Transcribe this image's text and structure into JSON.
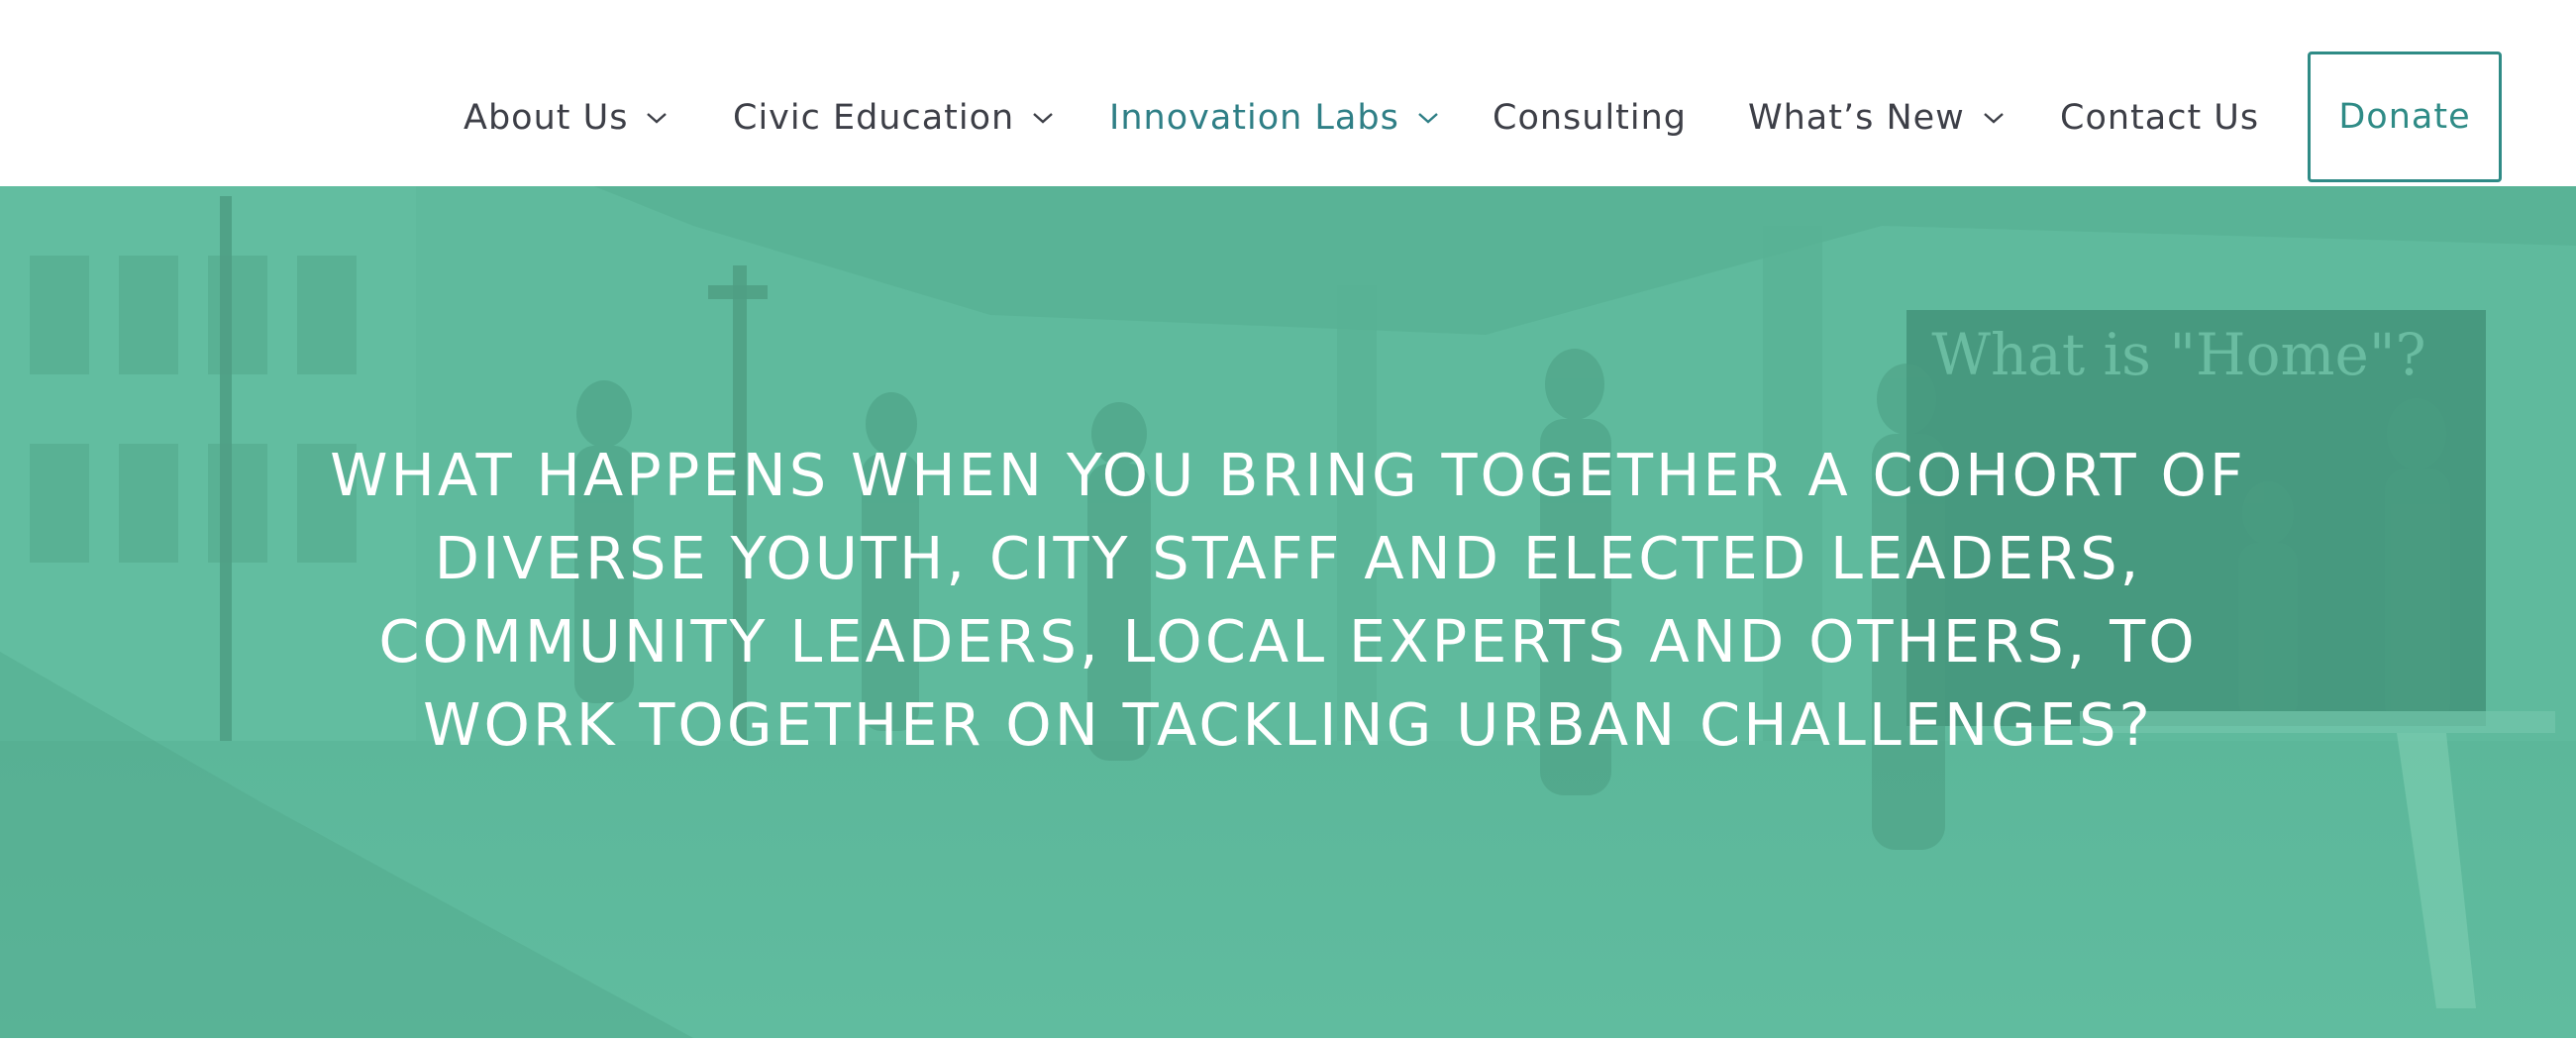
{
  "colors": {
    "nav_text": "#3d3f47",
    "nav_active": "#2f7f86",
    "donate_border": "#2f8b86",
    "hero_overlay": "#5fba9d",
    "hero_text": "#ffffff"
  },
  "nav": {
    "items": [
      {
        "label": "About Us",
        "has_dropdown": true,
        "icon": "chevron-down-icon"
      },
      {
        "label": "Civic Education",
        "has_dropdown": true,
        "icon": "chevron-down-icon"
      },
      {
        "label": "Innovation Labs",
        "has_dropdown": true,
        "icon": "chevron-down-icon",
        "active": true
      },
      {
        "label": "Consulting",
        "has_dropdown": false
      },
      {
        "label": "What’s New",
        "has_dropdown": true,
        "icon": "chevron-down-icon"
      },
      {
        "label": "Contact Us",
        "has_dropdown": false
      }
    ],
    "donate_label": "Donate"
  },
  "hero": {
    "lines": [
      "WHAT HAPPENS WHEN YOU BRING TOGETHER A COHORT OF",
      "DIVERSE YOUTH, CITY STAFF AND ELECTED LEADERS,",
      "COMMUNITY LEADERS, LOCAL EXPERTS AND OTHERS, TO",
      "WORK TOGETHER ON TACKLING URBAN CHALLENGES?"
    ],
    "chalkboard_text": "What is \"Home\"?"
  }
}
